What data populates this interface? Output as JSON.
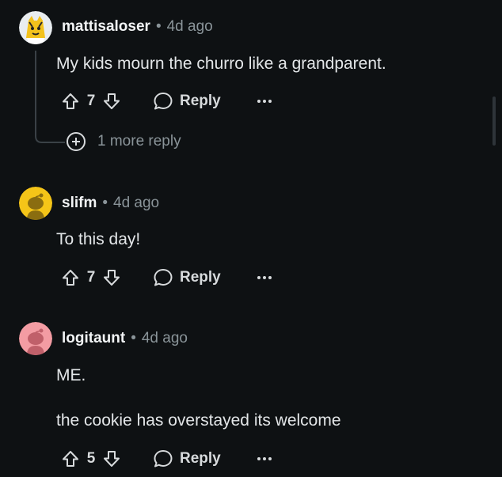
{
  "comments": [
    {
      "author": "mattisaloser",
      "separator": "•",
      "time": "4d ago",
      "body": [
        "My kids mourn the churro like a grandparent."
      ],
      "score": "7",
      "reply_label": "Reply",
      "more_replies_label": "1 more reply"
    },
    {
      "author": "slifm",
      "separator": "•",
      "time": "4d ago",
      "body": [
        "To this day!"
      ],
      "score": "7",
      "reply_label": "Reply"
    },
    {
      "author": "logitaunt",
      "separator": "•",
      "time": "4d ago",
      "body": [
        "ME.",
        "the cookie has overstayed its welcome"
      ],
      "score": "5",
      "reply_label": "Reply"
    }
  ],
  "icons": {
    "upvote": "upvote-icon",
    "downvote": "downvote-icon",
    "reply": "reply-bubble-icon",
    "more": "more-options-icon",
    "expand": "plus-circle-icon"
  },
  "colors": {
    "background": "#0e1113",
    "avatar_yellow": "#f5c518",
    "avatar_pink": "#f39ca3"
  }
}
